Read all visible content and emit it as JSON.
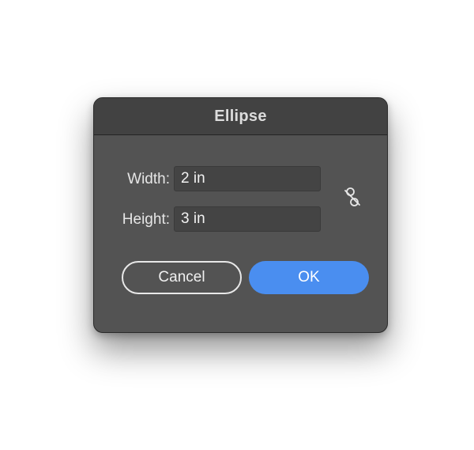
{
  "dialog": {
    "title": "Ellipse",
    "width_label": "Width:",
    "width_value": "2 in",
    "height_label": "Height:",
    "height_value": "3 in",
    "link_icon": "unlinked-chain-icon",
    "cancel_label": "Cancel",
    "ok_label": "OK"
  },
  "colors": {
    "dialog_bg": "#535353",
    "titlebar_bg": "#424242",
    "input_bg": "#444444",
    "accent": "#4a8ef0"
  }
}
